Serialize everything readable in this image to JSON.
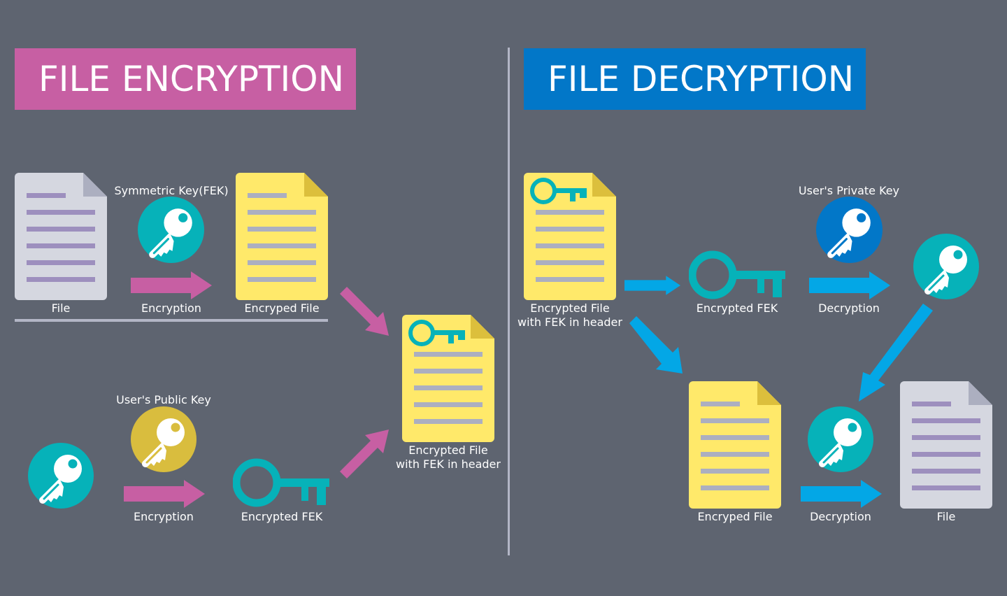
{
  "sections": {
    "encryption": {
      "title": "FILE ENCRYPTION",
      "color": "#c75fa3",
      "labels": {
        "file": "File",
        "symmetric_key": "Symmetric Key(FEK)",
        "encryption_1": "Encryption",
        "encrypted_file": "Encryped File",
        "public_key": "User's Public Key",
        "encryption_2": "Encryption",
        "encrypted_fek": "Encrypted FEK",
        "result_line1": "Encrypted File",
        "result_line2": "with FEK in header"
      }
    },
    "decryption": {
      "title": "FILE DECRYPTION",
      "color": "#0277c8",
      "labels": {
        "source_line1": "Encrypted File",
        "source_line2": "with FEK in header",
        "encrypted_fek": "Encrypted FEK",
        "private_key": "User's Private Key",
        "decryption_1": "Decryption",
        "encrypted_file": "Encryped File",
        "decryption_2": "Decryption",
        "file": "File"
      }
    }
  },
  "colors": {
    "background": "#5e6470",
    "teal": "#06b2b9",
    "gold": "#d9bd3e",
    "private_blue": "#0277c8",
    "arrow_pink": "#c75fa3",
    "arrow_blue": "#03a7e6",
    "doc_yellow": "#ffe96a",
    "doc_gray": "#d5d7e0"
  }
}
